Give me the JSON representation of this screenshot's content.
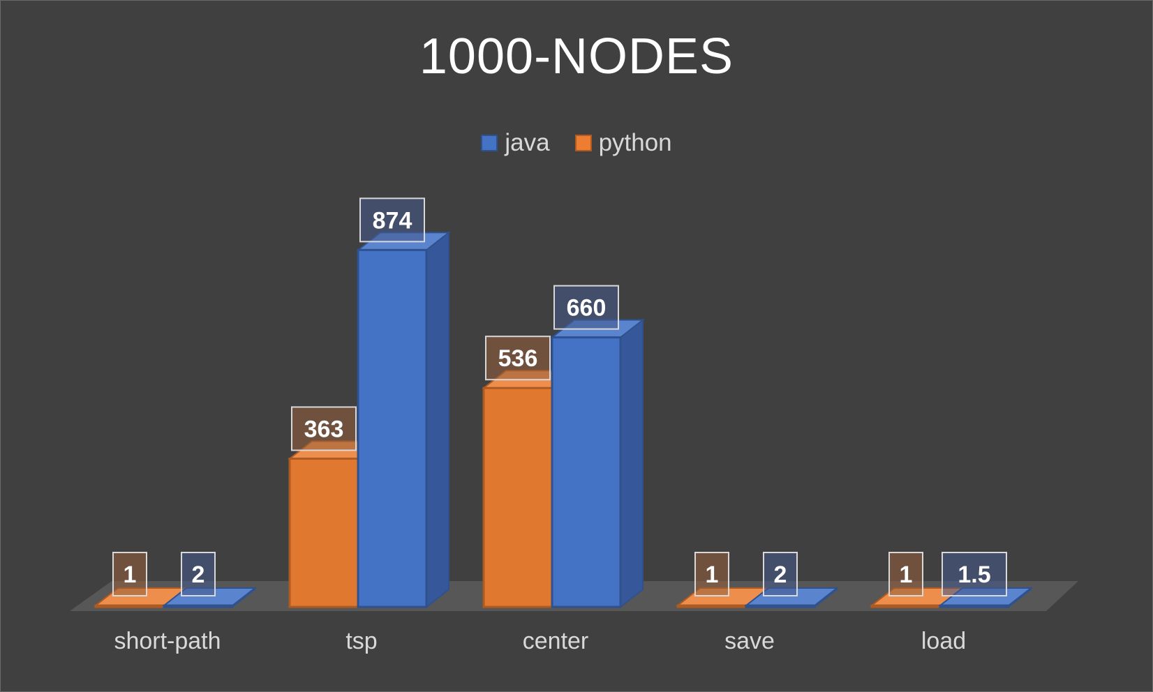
{
  "chart_data": {
    "type": "bar",
    "title": "1000-NODES",
    "categories": [
      "short-path",
      "tsp",
      "center",
      "save",
      "load"
    ],
    "series": [
      {
        "name": "java",
        "values": [
          2,
          874,
          660,
          2,
          1.5
        ]
      },
      {
        "name": "python",
        "values": [
          1,
          363,
          536,
          1,
          1
        ]
      }
    ],
    "data_labels": true,
    "legend": "top-center",
    "grid": false,
    "three_d": true,
    "draw_order": [
      "python",
      "java"
    ]
  },
  "colors": {
    "background": "#404040",
    "java": "#4472c4",
    "python": "#ed7d31",
    "text": "#d9d9d9"
  }
}
